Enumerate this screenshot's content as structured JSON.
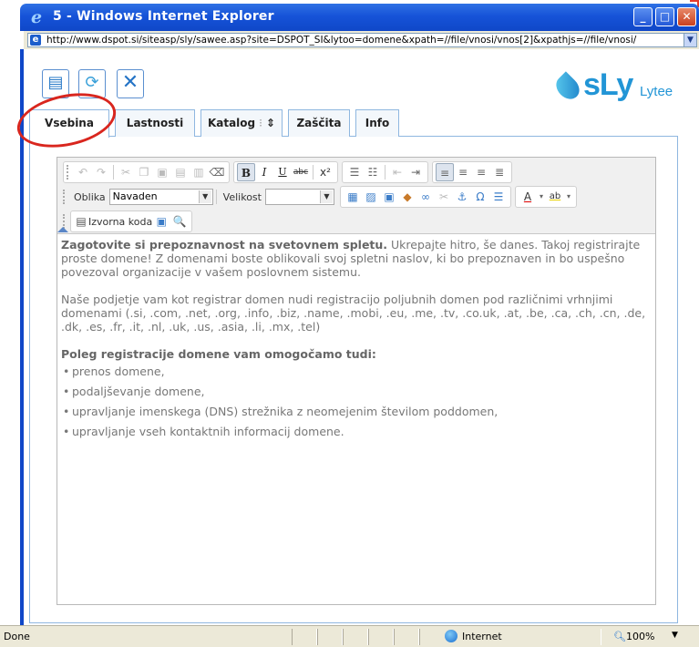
{
  "window": {
    "title": "5 - Windows Internet Explorer",
    "address": "http://www.dspot.si/siteasp/sly/sawee.asp?site=DSPOT_SI&lytoo=domene&xpath=//file/vnosi/vnos[2]&xpathjs=//file/vnosi/"
  },
  "app": {
    "logo_main": "sLy",
    "logo_sub": "Lytee"
  },
  "tabs": [
    {
      "label": "Vsebina"
    },
    {
      "label": "Lastnosti"
    },
    {
      "label": "Katalog"
    },
    {
      "label": "Zaščita"
    },
    {
      "label": "Info"
    }
  ],
  "editor": {
    "format_label": "Oblika",
    "format_value": "Navaden",
    "size_label": "Velikost",
    "size_value": "",
    "source_label": "Izvorna koda",
    "content": {
      "intro_bold": "Zagotovite si prepoznavnost na svetovnem spletu.",
      "intro_rest": " Ukrepajte hitro, še danes. Takoj registrirajte proste domene! Z domenami boste oblikovali svoj spletni naslov, ki bo prepoznaven in bo uspešno povezoval organizacije v vašem poslovnem sistemu.",
      "paragraph2": "Naše podjetje vam kot registrar domen nudi registracijo poljubnih domen pod različnimi vrhnjimi domenami (.si, .com, .net, .org, .info, .biz, .name, .mobi, .eu, .me, .tv, .co.uk, .at, .be, .ca, .ch, .cn, .de, .dk, .es, .fr, .it, .nl, .uk, .us, .asia, .li, .mx, .tel)",
      "list_heading": "Poleg registracije domene vam omogočamo tudi:",
      "list": [
        "prenos domene,",
        "podaljševanje domene,",
        "upravljanje imenskega (DNS) strežnika z neomejenim številom poddomen,",
        "upravljanje vseh kontaktnih informacij domene."
      ]
    }
  },
  "status": {
    "text": "Done",
    "zone": "Internet",
    "zoom": "100%"
  },
  "colors": {
    "titlebar": "#1653d8",
    "accent": "#2295d6",
    "annotation": "#d9261e"
  }
}
